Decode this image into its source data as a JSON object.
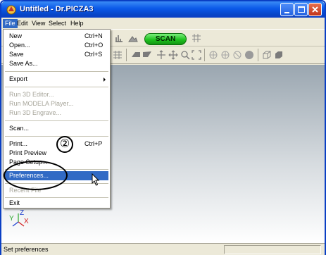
{
  "window": {
    "title": "Untitled - Dr.PICZA3"
  },
  "titlebar_buttons": [
    "minimize",
    "maximize",
    "close"
  ],
  "menubar": {
    "items": [
      {
        "label": "File",
        "active": true
      },
      {
        "label": "Edit",
        "active": false
      },
      {
        "label": "View",
        "active": false
      },
      {
        "label": "Select",
        "active": false
      },
      {
        "label": "Help",
        "active": false
      }
    ]
  },
  "toolbar": {
    "scan_label": "SCAN"
  },
  "file_menu": {
    "items": [
      {
        "label": "New",
        "accel": "Ctrl+N",
        "disabled": false
      },
      {
        "label": "Open...",
        "accel": "Ctrl+O",
        "disabled": false
      },
      {
        "label": "Save",
        "accel": "Ctrl+S",
        "disabled": false
      },
      {
        "label": "Save As...",
        "accel": "",
        "disabled": false
      },
      {
        "label": "Export",
        "accel": "",
        "disabled": false,
        "submenu": true
      },
      {
        "label": "Run 3D Editor...",
        "accel": "",
        "disabled": true
      },
      {
        "label": "Run MODELA Player...",
        "accel": "",
        "disabled": true
      },
      {
        "label": "Run 3D Engrave...",
        "accel": "",
        "disabled": true
      },
      {
        "label": "Scan...",
        "accel": "",
        "disabled": false
      },
      {
        "label": "Print...",
        "accel": "Ctrl+P",
        "disabled": false
      },
      {
        "label": "Print Preview",
        "accel": "",
        "disabled": false
      },
      {
        "label": "Page Setup...",
        "accel": "",
        "disabled": false
      },
      {
        "label": "Preferences...",
        "accel": "",
        "disabled": false,
        "highlighted": true
      },
      {
        "label": "Recent File",
        "accel": "",
        "disabled": true
      },
      {
        "label": "Exit",
        "accel": "",
        "disabled": false
      }
    ]
  },
  "callout": {
    "number": "②"
  },
  "axes": {
    "x_label": "X",
    "y_label": "Y",
    "z_label": "Z"
  },
  "statusbar": {
    "text": "Set preferences"
  },
  "colors": {
    "titlebar": "#0a58e8",
    "menu_highlight": "#316ac5",
    "scan_button": "#1fc21f"
  }
}
